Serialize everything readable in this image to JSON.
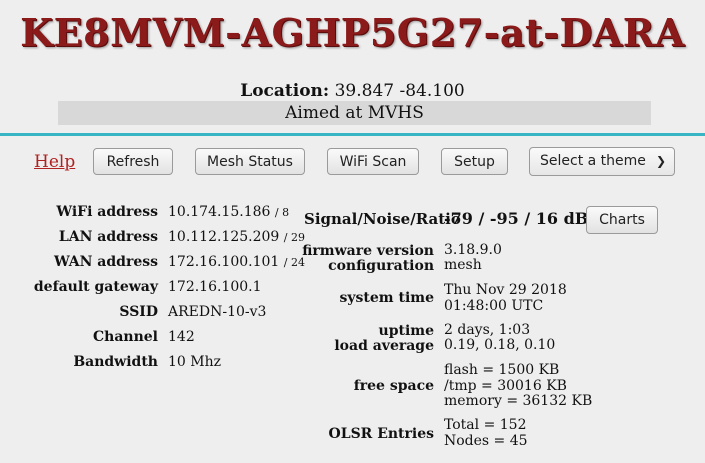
{
  "header": {
    "node_name": "KE8MVM-AGHP5G27-at-DARA",
    "location_label": "Location:",
    "location_value": "39.847 -84.100",
    "aimed_text": "Aimed at MVHS"
  },
  "nav": {
    "help": "Help",
    "refresh": "Refresh",
    "mesh_status": "Mesh Status",
    "wifi_scan": "WiFi Scan",
    "setup": "Setup",
    "theme_select": "Select a theme"
  },
  "left": {
    "wifi_label": "WiFi address",
    "wifi_ip": "10.174.15.186",
    "wifi_mask": "/ 8",
    "lan_label": "LAN address",
    "lan_ip": "10.112.125.209",
    "lan_mask": "/ 29",
    "wan_label": "WAN address",
    "wan_ip": "172.16.100.101",
    "wan_mask": "/ 24",
    "gw_label": "default gateway",
    "gw_value": "172.16.100.1",
    "ssid_label": "SSID",
    "ssid_value": "AREDN-10-v3",
    "channel_label": "Channel",
    "channel_value": "142",
    "bw_label": "Bandwidth",
    "bw_value": "10 Mhz"
  },
  "right": {
    "signal_label": "Signal/Noise/Ratio",
    "signal_value": "-79 / -95 / 16 dB",
    "charts_button": "Charts",
    "fw_label": "firmware version",
    "fw_value": "3.18.9.0",
    "config_label": "configuration",
    "config_value": "mesh",
    "time_label": "system time",
    "time_date": "Thu Nov 29 2018",
    "time_clock": "01:48:00 UTC",
    "uptime_label": "uptime",
    "uptime_value": "2 days, 1:03",
    "load_label": "load average",
    "load_value": "0.19, 0.18, 0.10",
    "free_label": "free space",
    "free_flash": "flash = 1500 KB",
    "free_tmp": "/tmp = 30016 KB",
    "free_memory": "memory = 36132 KB",
    "olsr_label": "OLSR Entries",
    "olsr_total": "Total = 152",
    "olsr_nodes": "Nodes = 45"
  },
  "colors": {
    "title": "#8b1a1a",
    "accent_line": "#37b5c4",
    "help_link": "#b02222",
    "background": "#eeeeee"
  }
}
